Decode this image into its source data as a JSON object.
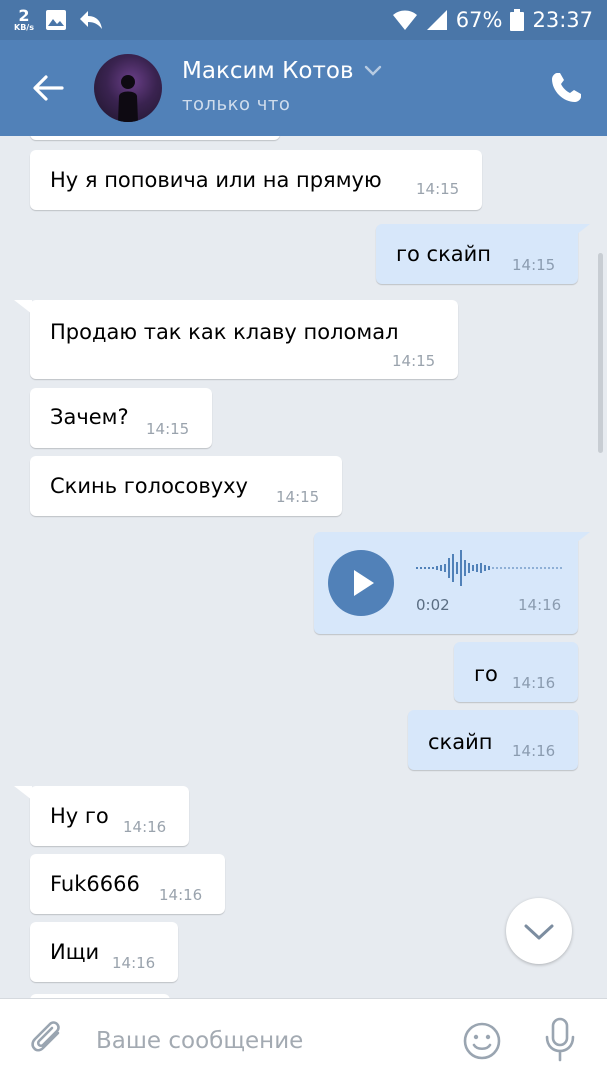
{
  "status_bar": {
    "speed_value": "2",
    "speed_unit": "KB/s",
    "battery": "67%",
    "time": "23:37"
  },
  "header": {
    "contact_name": "Максим Котов",
    "status": "только что"
  },
  "messages": [
    {
      "dir": "in",
      "text": "Ну я поповича или на прямую",
      "time": "14:15"
    },
    {
      "dir": "out",
      "text": "го скайп",
      "time": "14:15"
    },
    {
      "dir": "in",
      "text": "Продаю так как клаву поломал",
      "time": "14:15"
    },
    {
      "dir": "in",
      "text": "Зачем?",
      "time": "14:15"
    },
    {
      "dir": "in",
      "text": "Скинь голосовуху",
      "time": "14:15"
    },
    {
      "dir": "out",
      "type": "voice",
      "duration": "0:02",
      "time": "14:16"
    },
    {
      "dir": "out",
      "text": "го",
      "time": "14:16"
    },
    {
      "dir": "out",
      "text": "скайп",
      "time": "14:16"
    },
    {
      "dir": "in",
      "text": "Ну го",
      "time": "14:16"
    },
    {
      "dir": "in",
      "text": "Fuk6666",
      "time": "14:16"
    },
    {
      "dir": "in",
      "text": "Ищи",
      "time": "14:16"
    }
  ],
  "composer": {
    "placeholder": "Ваше сообщение"
  },
  "colors": {
    "header": "#5181b8",
    "status_bar": "#4a76a8",
    "chat_bg": "#e7ebf0",
    "incoming_bubble": "#ffffff",
    "outgoing_bubble": "#d7e7fa"
  },
  "icons": [
    "back-arrow-icon",
    "call-icon",
    "play-icon",
    "chevron-down-icon",
    "attach-icon",
    "emoji-icon",
    "mic-icon"
  ]
}
